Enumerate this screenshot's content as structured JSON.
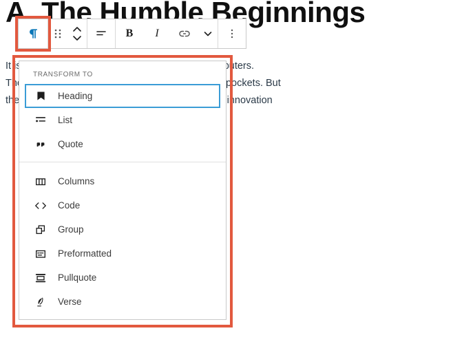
{
  "document": {
    "heading": "A. The Humble Beginnings",
    "paragraphs": [
      "It is almost impossible to imagine life without computers.",
      "They are on our desks, in our homes, even in our pockets. But",
      "these machines are the result of a long journey of innovation"
    ]
  },
  "toolbar": {
    "buttons": [
      {
        "name": "paragraph-block-type",
        "icon": "paragraph-icon",
        "tooltip": "Paragraph"
      },
      {
        "name": "drag-handle",
        "icon": "drag-handle-icon",
        "tooltip": "Drag"
      },
      {
        "name": "move-updown",
        "icon": "move-up-down-icon",
        "tooltip": "Move up or down"
      },
      {
        "name": "align-text",
        "icon": "align-text-icon",
        "tooltip": "Align text"
      },
      {
        "name": "bold",
        "icon": "bold-icon",
        "label": "B",
        "tooltip": "Bold"
      },
      {
        "name": "italic",
        "icon": "italic-icon",
        "label": "I",
        "tooltip": "Italic"
      },
      {
        "name": "link",
        "icon": "link-icon",
        "tooltip": "Link"
      },
      {
        "name": "more-rich-text",
        "icon": "chevron-down-icon",
        "tooltip": "More"
      },
      {
        "name": "options",
        "icon": "more-vertical-icon",
        "tooltip": "Options"
      }
    ]
  },
  "menu": {
    "section_label": "TRANSFORM TO",
    "groups": [
      {
        "items": [
          {
            "label": "Heading",
            "icon": "heading-icon",
            "selected": true
          },
          {
            "label": "List",
            "icon": "list-icon",
            "selected": false
          },
          {
            "label": "Quote",
            "icon": "quote-icon",
            "selected": false
          }
        ]
      },
      {
        "items": [
          {
            "label": "Columns",
            "icon": "columns-icon",
            "selected": false
          },
          {
            "label": "Code",
            "icon": "code-icon",
            "selected": false
          },
          {
            "label": "Group",
            "icon": "group-icon",
            "selected": false
          },
          {
            "label": "Preformatted",
            "icon": "preformatted-icon",
            "selected": false
          },
          {
            "label": "Pullquote",
            "icon": "pullquote-icon",
            "selected": false
          },
          {
            "label": "Verse",
            "icon": "verse-icon",
            "selected": false
          }
        ]
      }
    ]
  },
  "annotations": {
    "highlight_color": "#e2593f",
    "selection_color": "#3a9cd6",
    "active_icon_color": "#0b77b8",
    "boxes": [
      {
        "name": "paragraph-button-highlight"
      },
      {
        "name": "transform-menu-highlight"
      }
    ]
  }
}
